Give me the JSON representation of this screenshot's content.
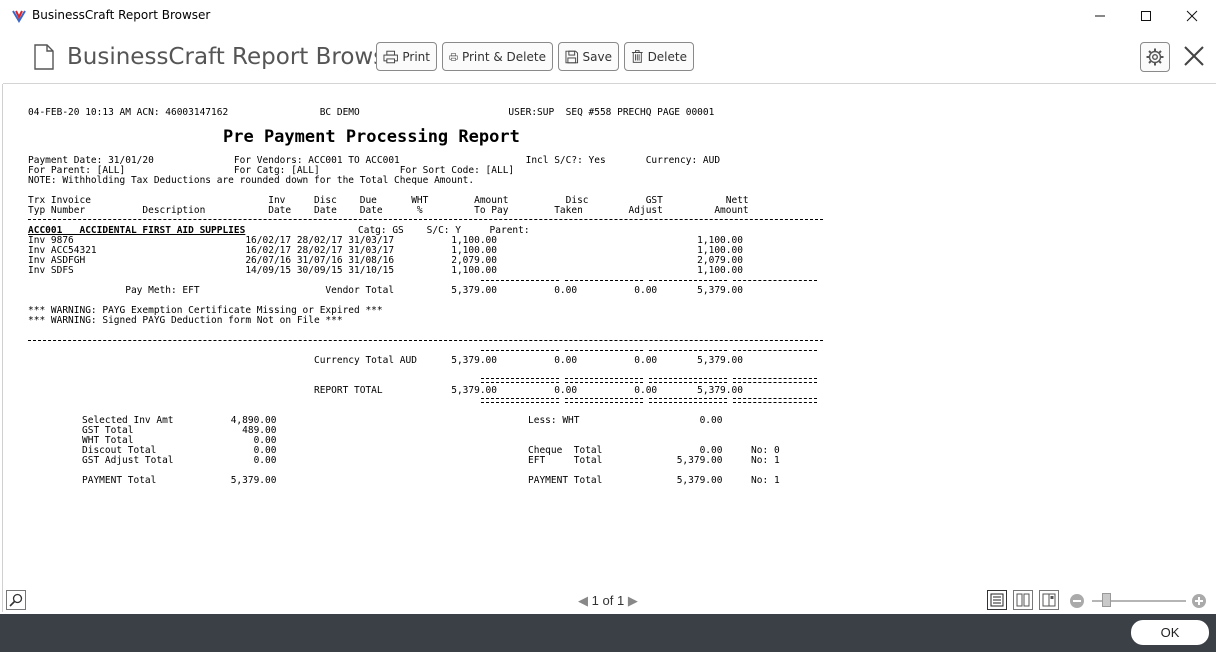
{
  "window": {
    "title": "BusinessCraft Report Browser",
    "controls": [
      "minimize-icon",
      "maximize-icon",
      "close-icon"
    ]
  },
  "toolbar": {
    "app_title": "BusinessCraft Report Browser",
    "print_label": "Print",
    "print_delete_label": "Print & Delete",
    "save_label": "Save",
    "delete_label": "Delete"
  },
  "report": {
    "header_line": "04-FEB-20 10:13 AM ACN: 46003147162                BC DEMO                          USER:SUP  SEQ #558 PRECHQ PAGE 00001",
    "title": "Pre Payment Processing Report",
    "params": [
      "Payment Date: 31/01/20              For Vendors: ACC001 TO ACC001                      Incl S/C?: Yes       Currency: AUD",
      "For Parent: [ALL]                   For Catg: [ALL]              For Sort Code: [ALL]",
      "NOTE: Withholding Tax Deductions are rounded down for the Total Cheque Amount."
    ],
    "col_headers": [
      "Trx Invoice                               Inv     Disc    Due      WHT        Amount          Disc          GST           Nett",
      "Typ Number          Description           Date    Date    Date      %         To Pay        Taken        Adjust         Amount"
    ],
    "vendor_heading": "ACC001   ACCIDENTAL FIRST AID SUPPLIES",
    "vendor_catg": "Catg: GS    S/C: Y     Parent:",
    "rows": [
      "Inv 9876                              16/02/17 28/02/17 31/03/17          1,100.00                                   1,100.00",
      "Inv ACC54321                          16/02/17 28/02/17 31/03/17          1,100.00                                   1,100.00",
      "Inv ASDFGH                            26/07/16 31/07/16 31/08/16          2,079.00                                   2,079.00",
      "Inv SDFS                              14/09/15 30/09/15 31/10/15          1,100.00                                   1,100.00"
    ],
    "vendor_total_line": "                 Pay Meth: EFT                      Vendor Total          5,379.00          0.00          0.00       5,379.00",
    "warnings": [
      "*** WARNING: PAYG Exemption Certificate Missing or Expired ***",
      "*** WARNING: Signed PAYG Deduction form Not on File ***"
    ],
    "currency_total_line": "                                                  Currency Total AUD      5,379.00          0.00          0.00       5,379.00",
    "report_total_line": "                                                  REPORT TOTAL            5,379.00          0.00          0.00       5,379.00",
    "summary_left": [
      "Selected Inv Amt          4,890.00",
      "GST Total                   489.00",
      "WHT Total                     0.00",
      "Discout Total                 0.00",
      "GST Adjust Total              0.00",
      "",
      "PAYMENT Total             5,379.00"
    ],
    "summary_right": [
      "Less: WHT                     0.00",
      "",
      "",
      "Cheque  Total                 0.00     No: 0",
      "EFT     Total             5,379.00     No: 1",
      "",
      "PAYMENT Total             5,379.00     No: 1"
    ]
  },
  "pager": {
    "current": "1",
    "of_label": "of",
    "total": "1"
  },
  "footer": {
    "ok_label": "OK"
  }
}
